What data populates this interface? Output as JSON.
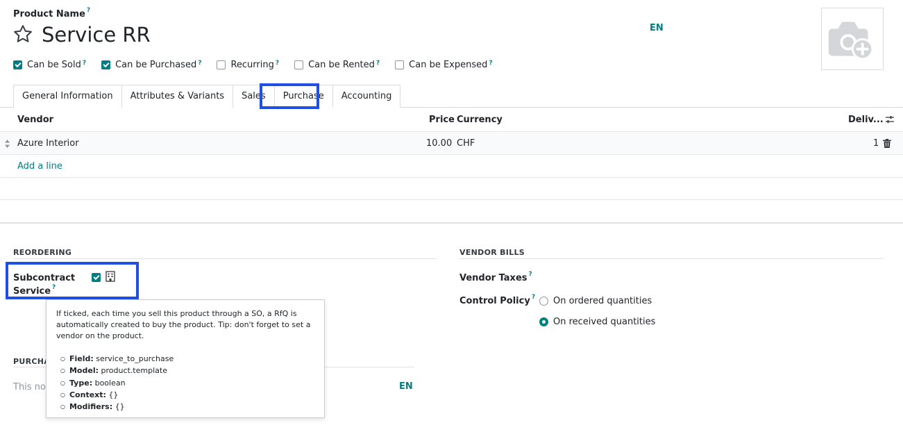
{
  "header": {
    "product_name_label": "Product Name",
    "help_mark": "?",
    "title": "Service RR",
    "lang": "EN"
  },
  "checkboxes": [
    {
      "label": "Can be Sold",
      "checked": true
    },
    {
      "label": "Can be Purchased",
      "checked": true
    },
    {
      "label": "Recurring",
      "checked": false
    },
    {
      "label": "Can be Rented",
      "checked": false
    },
    {
      "label": "Can be Expensed",
      "checked": false
    }
  ],
  "tabs": [
    {
      "label": "General Information",
      "active": false
    },
    {
      "label": "Attributes & Variants",
      "active": false
    },
    {
      "label": "Sales",
      "active": false
    },
    {
      "label": "Purchase",
      "active": true
    },
    {
      "label": "Accounting",
      "active": false
    }
  ],
  "vendor_table": {
    "columns": {
      "vendor": "Vendor",
      "price": "Price",
      "currency": "Currency",
      "delivery": "Deliv..."
    },
    "rows": [
      {
        "vendor": "Azure Interior",
        "price": "10.00",
        "currency": "CHF",
        "delivery": "1"
      }
    ],
    "add_line": "Add a line"
  },
  "reordering": {
    "title": "REORDERING",
    "subcontract_label_1": "Subcontract",
    "subcontract_label_2": "Service",
    "subcontract_checked": true
  },
  "purchase_section": {
    "title": "PURCHA",
    "note_placeholder": "This not",
    "lang": "EN"
  },
  "vendor_bills": {
    "title": "VENDOR BILLS",
    "taxes_label": "Vendor Taxes",
    "control_policy_label": "Control Policy",
    "options": [
      {
        "label": "On ordered quantities",
        "selected": false
      },
      {
        "label": "On received quantities",
        "selected": true
      }
    ]
  },
  "tooltip": {
    "text": "If ticked, each time you sell this product through a SO, a RfQ is automatically created to buy the product. Tip: don't forget to set a vendor on the product.",
    "items": [
      {
        "key": "Field:",
        "value": "service_to_purchase"
      },
      {
        "key": "Model:",
        "value": "product.template"
      },
      {
        "key": "Type:",
        "value": "boolean"
      },
      {
        "key": "Context:",
        "value": "{}"
      },
      {
        "key": "Modifiers:",
        "value": "{}"
      }
    ]
  },
  "colors": {
    "accent": "#017e84",
    "highlight": "#1f4fe3"
  },
  "icons": [
    "star-icon",
    "camera-plus-icon",
    "sort-handle-icon",
    "settings-sliders-icon",
    "trash-icon",
    "building-icon"
  ]
}
